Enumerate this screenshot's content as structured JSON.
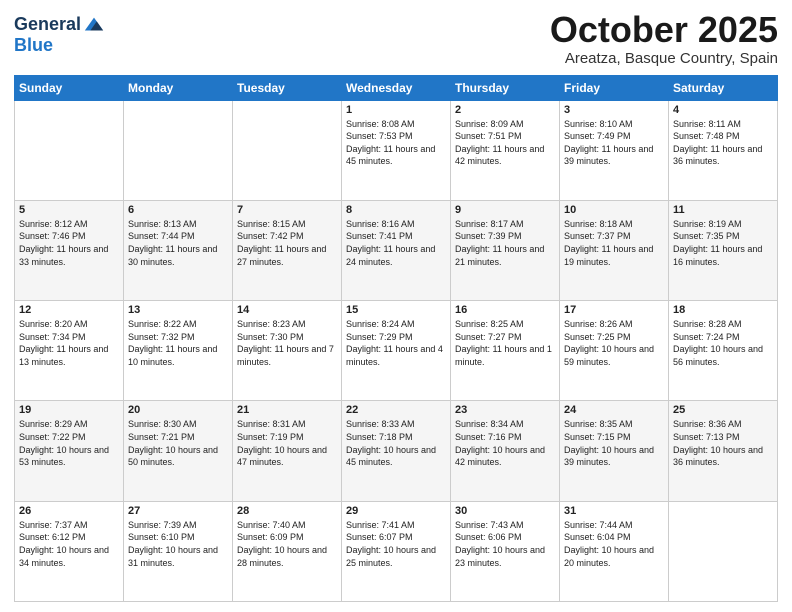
{
  "logo": {
    "general": "General",
    "blue": "Blue"
  },
  "header": {
    "month": "October 2025",
    "location": "Areatza, Basque Country, Spain"
  },
  "weekdays": [
    "Sunday",
    "Monday",
    "Tuesday",
    "Wednesday",
    "Thursday",
    "Friday",
    "Saturday"
  ],
  "weeks": [
    [
      null,
      null,
      null,
      {
        "day": 1,
        "sunrise": "8:08 AM",
        "sunset": "7:53 PM",
        "daylight": "11 hours and 45 minutes."
      },
      {
        "day": 2,
        "sunrise": "8:09 AM",
        "sunset": "7:51 PM",
        "daylight": "11 hours and 42 minutes."
      },
      {
        "day": 3,
        "sunrise": "8:10 AM",
        "sunset": "7:49 PM",
        "daylight": "11 hours and 39 minutes."
      },
      {
        "day": 4,
        "sunrise": "8:11 AM",
        "sunset": "7:48 PM",
        "daylight": "11 hours and 36 minutes."
      }
    ],
    [
      {
        "day": 5,
        "sunrise": "8:12 AM",
        "sunset": "7:46 PM",
        "daylight": "11 hours and 33 minutes."
      },
      {
        "day": 6,
        "sunrise": "8:13 AM",
        "sunset": "7:44 PM",
        "daylight": "11 hours and 30 minutes."
      },
      {
        "day": 7,
        "sunrise": "8:15 AM",
        "sunset": "7:42 PM",
        "daylight": "11 hours and 27 minutes."
      },
      {
        "day": 8,
        "sunrise": "8:16 AM",
        "sunset": "7:41 PM",
        "daylight": "11 hours and 24 minutes."
      },
      {
        "day": 9,
        "sunrise": "8:17 AM",
        "sunset": "7:39 PM",
        "daylight": "11 hours and 21 minutes."
      },
      {
        "day": 10,
        "sunrise": "8:18 AM",
        "sunset": "7:37 PM",
        "daylight": "11 hours and 19 minutes."
      },
      {
        "day": 11,
        "sunrise": "8:19 AM",
        "sunset": "7:35 PM",
        "daylight": "11 hours and 16 minutes."
      }
    ],
    [
      {
        "day": 12,
        "sunrise": "8:20 AM",
        "sunset": "7:34 PM",
        "daylight": "11 hours and 13 minutes."
      },
      {
        "day": 13,
        "sunrise": "8:22 AM",
        "sunset": "7:32 PM",
        "daylight": "11 hours and 10 minutes."
      },
      {
        "day": 14,
        "sunrise": "8:23 AM",
        "sunset": "7:30 PM",
        "daylight": "11 hours and 7 minutes."
      },
      {
        "day": 15,
        "sunrise": "8:24 AM",
        "sunset": "7:29 PM",
        "daylight": "11 hours and 4 minutes."
      },
      {
        "day": 16,
        "sunrise": "8:25 AM",
        "sunset": "7:27 PM",
        "daylight": "11 hours and 1 minute."
      },
      {
        "day": 17,
        "sunrise": "8:26 AM",
        "sunset": "7:25 PM",
        "daylight": "10 hours and 59 minutes."
      },
      {
        "day": 18,
        "sunrise": "8:28 AM",
        "sunset": "7:24 PM",
        "daylight": "10 hours and 56 minutes."
      }
    ],
    [
      {
        "day": 19,
        "sunrise": "8:29 AM",
        "sunset": "7:22 PM",
        "daylight": "10 hours and 53 minutes."
      },
      {
        "day": 20,
        "sunrise": "8:30 AM",
        "sunset": "7:21 PM",
        "daylight": "10 hours and 50 minutes."
      },
      {
        "day": 21,
        "sunrise": "8:31 AM",
        "sunset": "7:19 PM",
        "daylight": "10 hours and 47 minutes."
      },
      {
        "day": 22,
        "sunrise": "8:33 AM",
        "sunset": "7:18 PM",
        "daylight": "10 hours and 45 minutes."
      },
      {
        "day": 23,
        "sunrise": "8:34 AM",
        "sunset": "7:16 PM",
        "daylight": "10 hours and 42 minutes."
      },
      {
        "day": 24,
        "sunrise": "8:35 AM",
        "sunset": "7:15 PM",
        "daylight": "10 hours and 39 minutes."
      },
      {
        "day": 25,
        "sunrise": "8:36 AM",
        "sunset": "7:13 PM",
        "daylight": "10 hours and 36 minutes."
      }
    ],
    [
      {
        "day": 26,
        "sunrise": "7:37 AM",
        "sunset": "6:12 PM",
        "daylight": "10 hours and 34 minutes."
      },
      {
        "day": 27,
        "sunrise": "7:39 AM",
        "sunset": "6:10 PM",
        "daylight": "10 hours and 31 minutes."
      },
      {
        "day": 28,
        "sunrise": "7:40 AM",
        "sunset": "6:09 PM",
        "daylight": "10 hours and 28 minutes."
      },
      {
        "day": 29,
        "sunrise": "7:41 AM",
        "sunset": "6:07 PM",
        "daylight": "10 hours and 25 minutes."
      },
      {
        "day": 30,
        "sunrise": "7:43 AM",
        "sunset": "6:06 PM",
        "daylight": "10 hours and 23 minutes."
      },
      {
        "day": 31,
        "sunrise": "7:44 AM",
        "sunset": "6:04 PM",
        "daylight": "10 hours and 20 minutes."
      },
      null
    ]
  ]
}
